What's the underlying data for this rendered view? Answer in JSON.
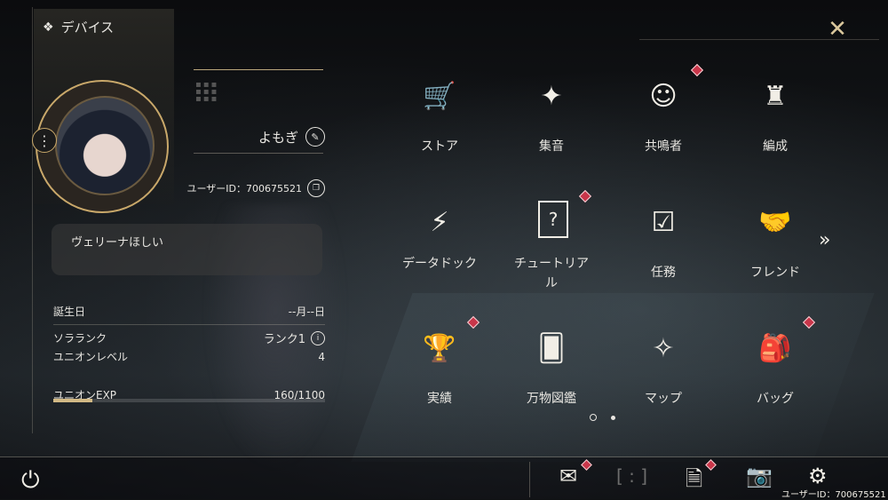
{
  "header": {
    "title": "デバイス"
  },
  "profile": {
    "name": "よもぎ",
    "user_id": "ユーザーID：700675521",
    "signature": "ヴェリーナほしい"
  },
  "stats": {
    "birthday_label": "誕生日",
    "birthday_value": "--月--日",
    "sola_rank_label": "ソラランク",
    "sola_rank_value": "ランク1",
    "union_level_label": "ユニオンレベル",
    "union_level_value": "4",
    "union_exp_label": "ユニオンEXP",
    "union_exp_value": "160/1100",
    "union_exp_progress": 0.145
  },
  "menu": [
    {
      "label": "ストア",
      "icon": "cart-icon",
      "badge": false
    },
    {
      "label": "集音",
      "icon": "compass-star-icon",
      "badge": false
    },
    {
      "label": "共鳴者",
      "icon": "character-icon",
      "badge": true
    },
    {
      "label": "編成",
      "icon": "team-icon",
      "badge": false
    },
    {
      "label": "データドック",
      "icon": "data-dock-icon",
      "badge": false
    },
    {
      "label": "チュートリアル",
      "icon": "tutorial-icon",
      "badge": true
    },
    {
      "label": "任務",
      "icon": "mission-icon",
      "badge": false
    },
    {
      "label": "フレンド",
      "icon": "handshake-icon",
      "badge": false
    },
    {
      "label": "実績",
      "icon": "trophy-icon",
      "badge": true
    },
    {
      "label": "万物図鑑",
      "icon": "cards-icon",
      "badge": false
    },
    {
      "label": "マップ",
      "icon": "map-compass-icon",
      "badge": false
    },
    {
      "label": "バッグ",
      "icon": "bag-icon",
      "badge": true
    }
  ],
  "pager": {
    "current": 1,
    "total": 2
  },
  "bottom": {
    "user_id": "ユーザーID：700675521"
  },
  "colors": {
    "accent": "#c9a86a",
    "badge": "#c9364a"
  }
}
